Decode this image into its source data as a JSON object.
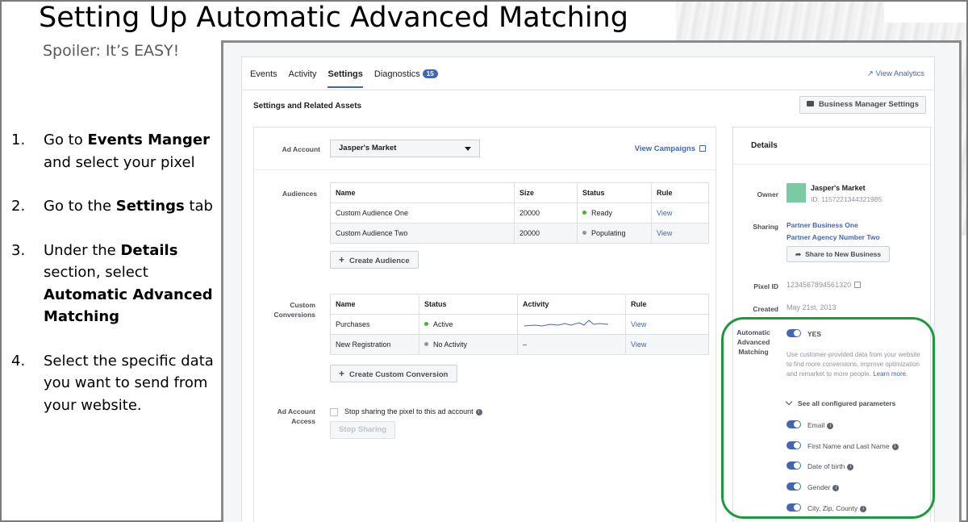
{
  "slide": {
    "title": "Setting Up Automatic Advanced Matching",
    "subtitle": "Spoiler: It’s EASY!",
    "steps": [
      {
        "num": "1.",
        "pre": "Go to ",
        "bold": "Events Manger",
        "post": " and select your pixel"
      },
      {
        "num": "2.",
        "pre": "Go to the ",
        "bold": "Settings",
        "post": " tab"
      },
      {
        "num": "3.",
        "pre": "Under the ",
        "bold": "Details",
        "mid": " section, select ",
        "bold2": "Automatic Advanced Matching"
      },
      {
        "num": "4.",
        "pre": "Select the specific data you want to send from your website."
      }
    ]
  },
  "tabs": [
    {
      "label": "Events"
    },
    {
      "label": "Activity"
    },
    {
      "label": "Settings",
      "active": true
    },
    {
      "label": "Diagnostics",
      "badge": "15"
    }
  ],
  "view_analytics": "View Analytics",
  "section_heading": "Settings and Related Assets",
  "business_manager_button": "Business Manager Settings",
  "ad_account": {
    "label": "Ad Account",
    "selected": "Jasper's Market",
    "view_campaigns": "View Campaigns"
  },
  "audiences": {
    "label": "Audiences",
    "headers": [
      "Name",
      "Size",
      "Status",
      "Rule"
    ],
    "rows": [
      {
        "name": "Custom Audience One",
        "size": "20000",
        "status": "Ready",
        "status_color": "#42b72a",
        "rule": "View"
      },
      {
        "name": "Custom Audience Two",
        "size": "20000",
        "status": "Populating",
        "status_color": "#90949c",
        "rule": "View"
      }
    ],
    "create_button": "Create Audience"
  },
  "custom_conversions": {
    "label": "Custom Conversions",
    "headers": [
      "Name",
      "Status",
      "Activity",
      "Rule"
    ],
    "rows": [
      {
        "name": "Purchases",
        "status": "Active",
        "status_color": "#42b72a",
        "activity": "sparkline",
        "rule": "View"
      },
      {
        "name": "New Registration",
        "status": "No Activity",
        "status_color": "#90949c",
        "activity": "–",
        "rule": "View"
      }
    ],
    "create_button": "Create Custom Conversion"
  },
  "ad_account_access": {
    "label": "Ad Account Access",
    "checkbox_label": "Stop sharing the pixel to this ad account",
    "stop_button": "Stop Sharing"
  },
  "details": {
    "title": "Details",
    "owner_label": "Owner",
    "owner_name": "Jasper's Market",
    "owner_id": "ID: 1157221344321985",
    "sharing_label": "Sharing",
    "sharing_partners": [
      "Partner Business One",
      "Partner Agency Number Two"
    ],
    "share_button": "Share to New Business",
    "pixel_id_label": "Pixel ID",
    "pixel_id": "1234567894561320",
    "created_label": "Created",
    "created": "May 21st, 2013",
    "aam_label": "Automatic Advanced Matching",
    "aam_value": "YES",
    "aam_description": "Use customer-provided data from your website to find more conversions, improve optimization and remarket to more people.",
    "learn_more": "Learn more.",
    "see_all": "See all configured parameters",
    "parameters": [
      "Email",
      "First Name and Last Name",
      "Date of birth",
      "Gender",
      "City, Zip, County"
    ]
  },
  "colors": {
    "accent": "#4267b2",
    "highlight": "#1a9a3a"
  }
}
